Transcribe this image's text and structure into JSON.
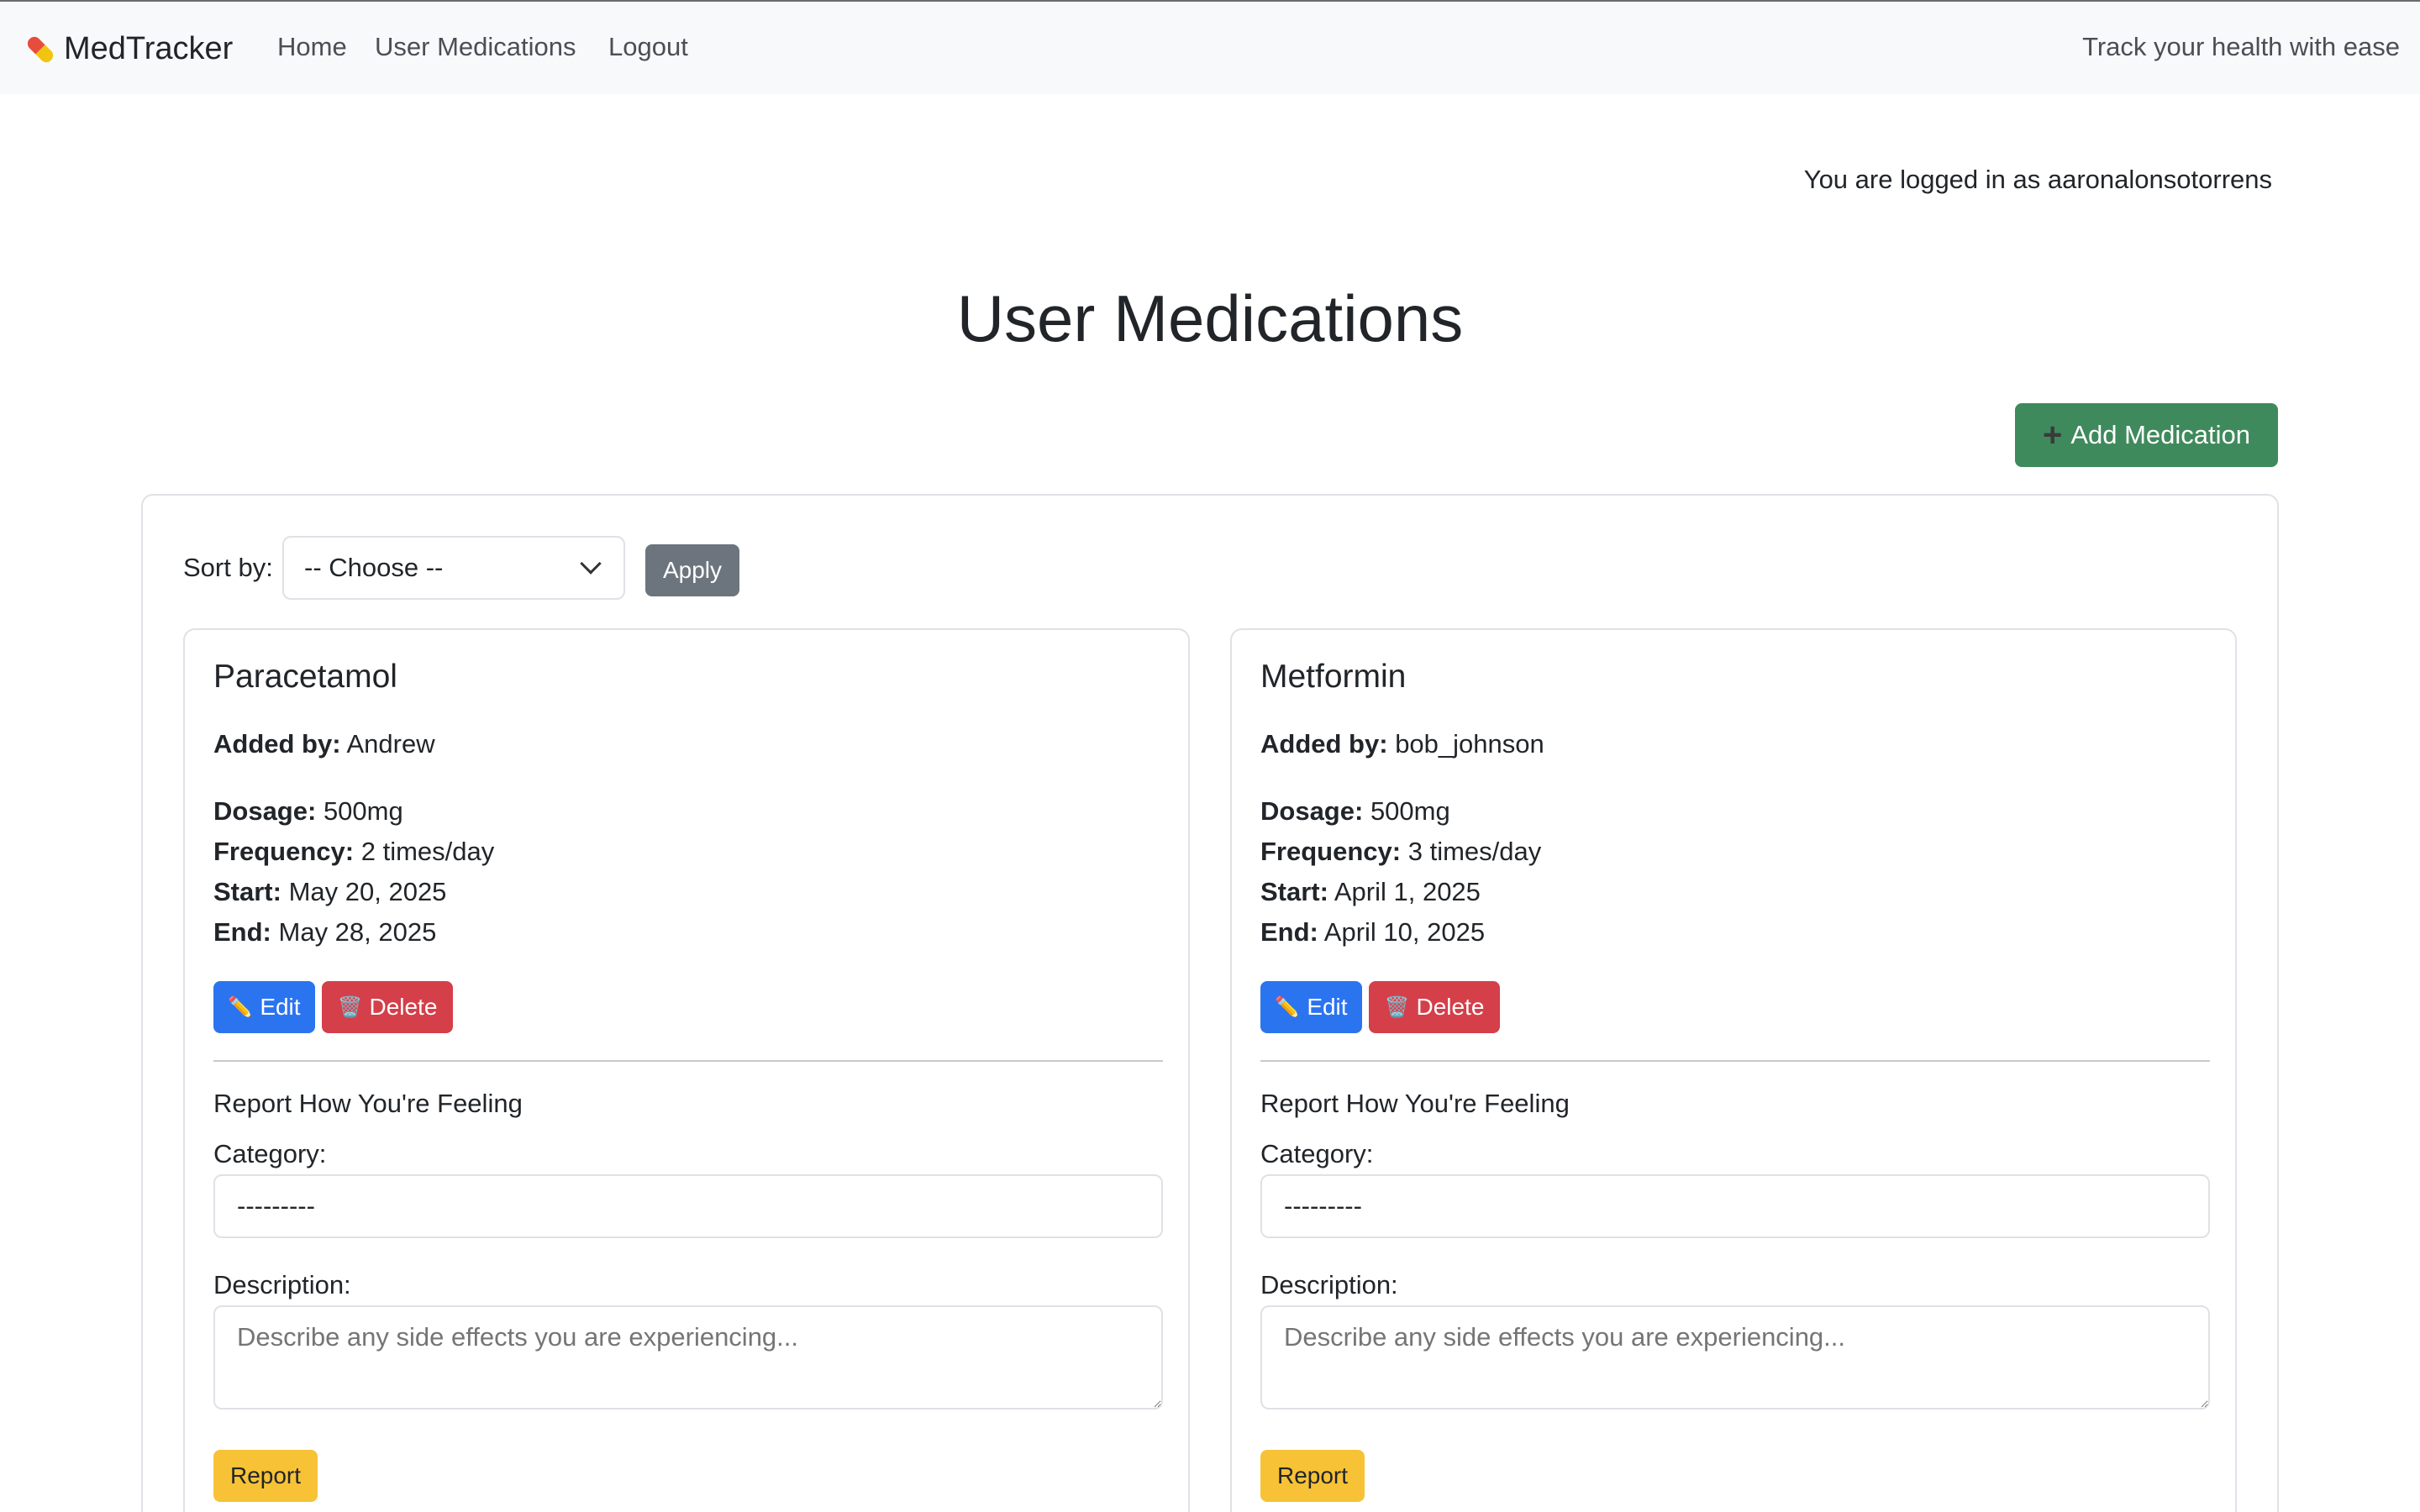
{
  "navbar": {
    "brand": "MedTracker",
    "brand_icon": "pill-icon",
    "links": [
      "Home",
      "User Medications",
      "Logout"
    ],
    "tagline": "Track your health with ease"
  },
  "login_status": "You are logged in as aaronalonsotorrens",
  "page_title": "User Medications",
  "add_button": {
    "icon": "plus-icon",
    "label": "Add Medication"
  },
  "sort": {
    "label": "Sort by:",
    "selected": "-- Choose --",
    "apply_label": "Apply"
  },
  "cards": [
    {
      "name": "Paracetamol",
      "added_by_label": "Added by:",
      "added_by": "Andrew",
      "dosage_label": "Dosage:",
      "dosage": "500mg",
      "frequency_label": "Frequency:",
      "frequency": "2 times/day",
      "start_label": "Start:",
      "start": "May 20, 2025",
      "end_label": "End:",
      "end": "May 28, 2025",
      "edit_label": "Edit",
      "delete_label": "Delete",
      "report_heading": "Report How You're Feeling",
      "category_label": "Category:",
      "category_value": "---------",
      "description_label": "Description:",
      "description_placeholder": "Describe any side effects you are experiencing...",
      "report_label": "Report"
    },
    {
      "name": "Metformin",
      "added_by_label": "Added by:",
      "added_by": "bob_johnson",
      "dosage_label": "Dosage:",
      "dosage": "500mg",
      "frequency_label": "Frequency:",
      "frequency": "3 times/day",
      "start_label": "Start:",
      "start": "April 1, 2025",
      "end_label": "End:",
      "end": "April 10, 2025",
      "edit_label": "Edit",
      "delete_label": "Delete",
      "report_heading": "Report How You're Feeling",
      "category_label": "Category:",
      "category_value": "---------",
      "description_label": "Description:",
      "description_placeholder": "Describe any side effects you are experiencing...",
      "report_label": "Report"
    }
  ],
  "colors": {
    "navbar_bg": "#f8f9fa",
    "success": "#3f8a5c",
    "primary": "#2b74f0",
    "danger": "#d43f4a",
    "warning": "#f7c236",
    "secondary": "#6c757d"
  }
}
